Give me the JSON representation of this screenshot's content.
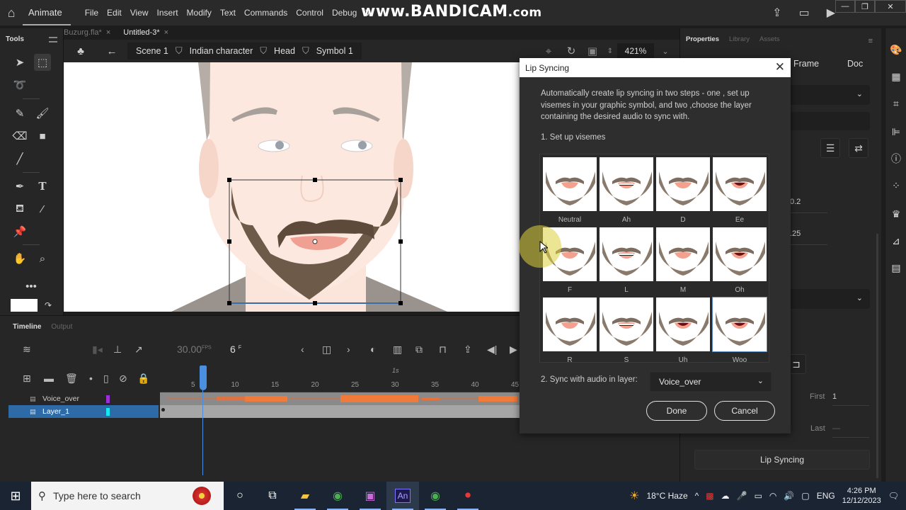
{
  "app": {
    "name": "Animate",
    "menus": [
      "File",
      "Edit",
      "View",
      "Insert",
      "Modify",
      "Text",
      "Commands",
      "Control",
      "Debug",
      "W"
    ],
    "watermark": "www.BANDICAM",
    "watermark_suffix": ".com"
  },
  "doc_tabs": [
    {
      "label": "Buzurg.fla*",
      "active": false
    },
    {
      "label": "Untitled-3*",
      "active": true
    }
  ],
  "tools_panel": {
    "title": "Tools"
  },
  "breadcrumb": [
    "Scene 1",
    "Indian character",
    "Head",
    "Symbol 1"
  ],
  "zoom_level": "421%",
  "timeline": {
    "tabs": [
      "Timeline",
      "Output"
    ],
    "fps": "30.00",
    "fps_unit": "FPS",
    "current_frame": "6",
    "frame_unit": "F",
    "ruler_numbers": [
      "5",
      "10",
      "15",
      "20",
      "25",
      "30",
      "35",
      "40",
      "45"
    ],
    "ruler_second_marker": "1s",
    "layers": [
      {
        "name": "Voice_over",
        "color": "#9b30d9",
        "selected": false
      },
      {
        "name": "Layer_1",
        "color": "#19e6f0",
        "selected": true
      }
    ]
  },
  "properties": {
    "tabs": [
      "Properties",
      "Library",
      "Assets"
    ],
    "subtabs": [
      "Frame",
      "Doc"
    ],
    "values": [
      "0.2",
      ".25"
    ],
    "first_label": "First",
    "first_value": "1",
    "last_label": "Last",
    "last_value": "—",
    "lip_sync_button": "Lip Syncing"
  },
  "dialog": {
    "title": "Lip Syncing",
    "description": "Automatically create lip syncing in two steps - one , set up visemes in your graphic symbol, and two ,choose the layer containing the desired audio to sync with.",
    "step1": "1. Set up visemes",
    "visemes": [
      {
        "label": "Neutral",
        "mouth": "closed",
        "selected": false
      },
      {
        "label": "Ah",
        "mouth": "teeth",
        "selected": false
      },
      {
        "label": "D",
        "mouth": "closed",
        "selected": false
      },
      {
        "label": "Ee",
        "mouth": "open",
        "selected": false
      },
      {
        "label": "F",
        "mouth": "closed",
        "selected": false
      },
      {
        "label": "L",
        "mouth": "teeth",
        "selected": false
      },
      {
        "label": "M",
        "mouth": "closed",
        "selected": false
      },
      {
        "label": "Oh",
        "mouth": "open",
        "selected": false
      },
      {
        "label": "R",
        "mouth": "closed",
        "selected": false
      },
      {
        "label": "S",
        "mouth": "teeth",
        "selected": false
      },
      {
        "label": "Uh",
        "mouth": "open",
        "selected": false
      },
      {
        "label": "Woo",
        "mouth": "open",
        "selected": true
      }
    ],
    "step2": "2. Sync with audio in layer:",
    "audio_layer": "Voice_over",
    "done": "Done",
    "cancel": "Cancel"
  },
  "taskbar": {
    "search_placeholder": "Type here to search",
    "weather": "18°C  Haze",
    "language": "ENG",
    "time": "4:26 PM",
    "date": "12/12/2023"
  }
}
